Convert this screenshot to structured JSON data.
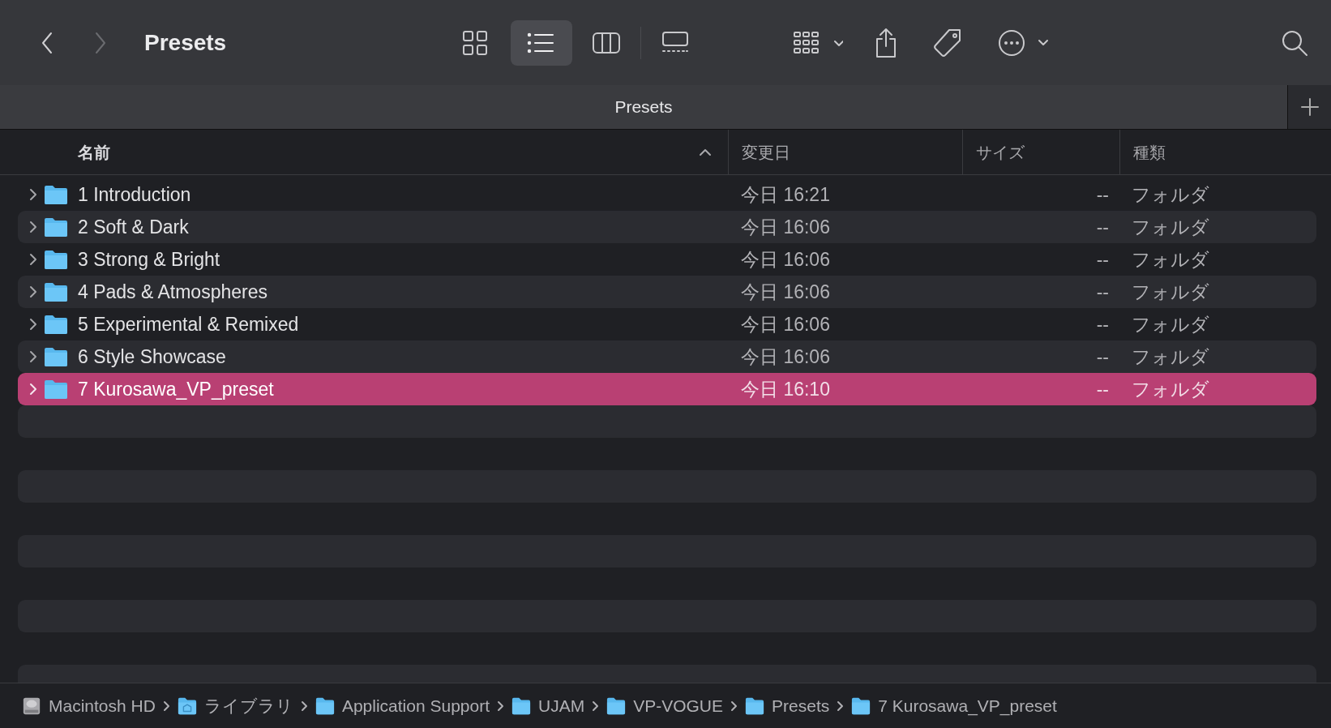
{
  "window": {
    "title": "Presets"
  },
  "view_buttons": [
    {
      "kind": "icons",
      "selected": false
    },
    {
      "kind": "list",
      "selected": true
    },
    {
      "kind": "columns",
      "selected": false
    },
    {
      "kind": "gallery",
      "selected": false
    }
  ],
  "tab": {
    "label": "Presets"
  },
  "columns": [
    {
      "label": "名前",
      "sorted": true
    },
    {
      "label": "変更日",
      "sorted": false
    },
    {
      "label": "サイズ",
      "sorted": false
    },
    {
      "label": "種類",
      "sorted": false
    }
  ],
  "rows": [
    {
      "name": "1 Introduction",
      "modified": "今日 16:21",
      "size": "--",
      "type": "フォルダ",
      "selected": false,
      "expanded": false
    },
    {
      "name": "2 Soft & Dark",
      "modified": "今日 16:06",
      "size": "--",
      "type": "フォルダ",
      "selected": false,
      "expanded": false
    },
    {
      "name": "3 Strong & Bright",
      "modified": "今日 16:06",
      "size": "--",
      "type": "フォルダ",
      "selected": false,
      "expanded": false
    },
    {
      "name": "4 Pads & Atmospheres",
      "modified": "今日 16:06",
      "size": "--",
      "type": "フォルダ",
      "selected": false,
      "expanded": false
    },
    {
      "name": "5 Experimental & Remixed",
      "modified": "今日 16:06",
      "size": "--",
      "type": "フォルダ",
      "selected": false,
      "expanded": false
    },
    {
      "name": "6 Style Showcase",
      "modified": "今日 16:06",
      "size": "--",
      "type": "フォルダ",
      "selected": false,
      "expanded": false
    },
    {
      "name": "7 Kurosawa_VP_preset",
      "modified": "今日 16:10",
      "size": "--",
      "type": "フォルダ",
      "selected": true,
      "expanded": false
    }
  ],
  "path_bar": [
    {
      "label": "Macintosh HD",
      "kind": "disk"
    },
    {
      "label": "ライブラリ",
      "kind": "library"
    },
    {
      "label": "Application Support",
      "kind": "folder"
    },
    {
      "label": "UJAM",
      "kind": "folder"
    },
    {
      "label": "VP-VOGUE",
      "kind": "folder"
    },
    {
      "label": "Presets",
      "kind": "folder"
    },
    {
      "label": "7 Kurosawa_VP_preset",
      "kind": "folder"
    }
  ]
}
